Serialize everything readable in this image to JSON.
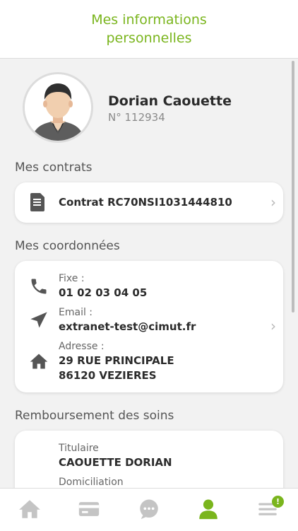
{
  "header": {
    "title_line1": "Mes informations",
    "title_line2": "personnelles"
  },
  "profile": {
    "name": "Dorian Caouette",
    "number": "N° 112934"
  },
  "contrats": {
    "title": "Mes contrats",
    "item": "Contrat RC70NSI1031444810"
  },
  "coordonnees": {
    "title": "Mes coordonnées",
    "fixe_label": "Fixe :",
    "fixe_value": "01 02 03 04 05",
    "email_label": "Email :",
    "email_value": "extranet-test@cimut.fr",
    "adresse_label": "Adresse :",
    "adresse_line1": "29 RUE PRINCIPALE",
    "adresse_line2": "86120 VEZIERES"
  },
  "remboursement": {
    "title": "Remboursement des soins",
    "titulaire_label": "Titulaire",
    "titulaire_value": "CAOUETTE DORIAN",
    "domiciliation_label": "Domiciliation"
  },
  "tabbar": {
    "badge": "!"
  },
  "colors": {
    "accent": "#7ab51d",
    "icon": "#555555",
    "tab_inactive": "#c4c4c4"
  }
}
